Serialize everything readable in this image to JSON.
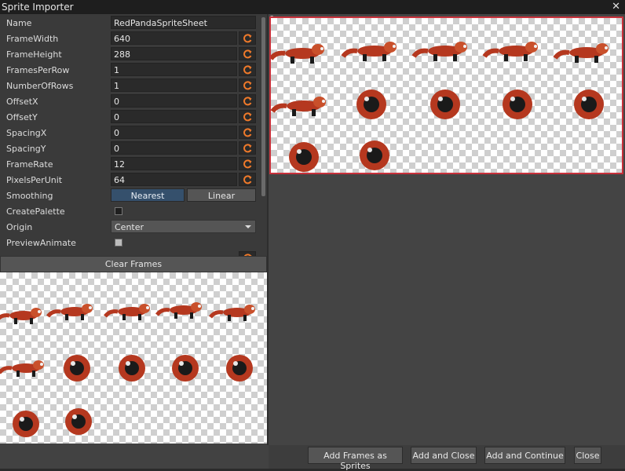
{
  "window": {
    "title": "Sprite Importer"
  },
  "properties": [
    {
      "label": "Name",
      "value": "RedPandaSpriteSheet",
      "kind": "text"
    },
    {
      "label": "FrameWidth",
      "value": "640",
      "kind": "number"
    },
    {
      "label": "FrameHeight",
      "value": "288",
      "kind": "number"
    },
    {
      "label": "FramesPerRow",
      "value": "1",
      "kind": "number"
    },
    {
      "label": "NumberOfRows",
      "value": "1",
      "kind": "number"
    },
    {
      "label": "OffsetX",
      "value": "0",
      "kind": "number"
    },
    {
      "label": "OffsetY",
      "value": "0",
      "kind": "number"
    },
    {
      "label": "SpacingX",
      "value": "0",
      "kind": "number"
    },
    {
      "label": "SpacingY",
      "value": "0",
      "kind": "number"
    },
    {
      "label": "FrameRate",
      "value": "12",
      "kind": "number"
    },
    {
      "label": "PixelsPerUnit",
      "value": "64",
      "kind": "number"
    }
  ],
  "smoothing": {
    "label": "Smoothing",
    "options": [
      "Nearest",
      "Linear"
    ],
    "selected": "Nearest"
  },
  "create_palette": {
    "label": "CreatePalette",
    "checked": false
  },
  "origin": {
    "label": "Origin",
    "value": "Center"
  },
  "preview_animate": {
    "label": "PreviewAnimate",
    "checked": false
  },
  "clear_frames_label": "Clear Frames",
  "preview": {
    "origin_marker": "0"
  },
  "buttons": {
    "add_frames_as_sprites": "Add Frames as Sprites",
    "add_and_close": "Add and Close",
    "add_and_continue": "Add and Continue",
    "close": "Close"
  },
  "icons": {
    "reset": "reset-icon",
    "close": "close-icon",
    "caret": "chevron-down-icon"
  },
  "colors": {
    "accent_selected": "#35506c",
    "sheet_border": "#c8313b",
    "panda_body": "#b5381f",
    "panda_dark": "#1a1a1a"
  }
}
